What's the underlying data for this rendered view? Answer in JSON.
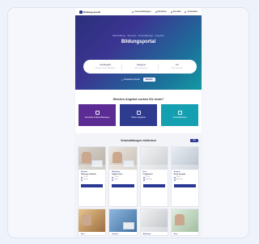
{
  "header": {
    "logo": "Bildungsportal",
    "nav": [
      "Veranstaltungen",
      "Merkliste",
      "Kontakt",
      "Anmelden"
    ]
  },
  "hero": {
    "breadcrumb": "Weiterbildung · Seminare · Veranstaltungen · Angebote",
    "title": "Bildungsportal",
    "search": {
      "fields": [
        {
          "label": "Suchbegriff",
          "placeholder": "Thema, Kurs, Stichwort"
        },
        {
          "label": "Kategorie",
          "placeholder": "Alle Kategorien"
        },
        {
          "label": "Ort",
          "placeholder": "PLZ oder Ort"
        }
      ]
    },
    "link_label": "Erweiterte Suche",
    "button_label": "Suchen"
  },
  "question": "Welches Angebot suchen Sie heute?",
  "tiles": [
    {
      "label": "Seminare & Weiterbildungen"
    },
    {
      "label": "Online-Angebote"
    },
    {
      "label": "Veranstaltungen"
    }
  ],
  "events": {
    "title": "Veranstaltungen entdecken",
    "all_label": "Alle",
    "cards": [
      {
        "category": "Seminar",
        "title": "Führung im Wandel",
        "date": "12.03.",
        "place": "Online"
      },
      {
        "category": "Workshop",
        "title": "Digitale Lehre",
        "date": "18.03.",
        "place": "Berlin"
      },
      {
        "category": "Kurs",
        "title": "Projektarbeit",
        "date": "22.03.",
        "place": "Hamburg"
      },
      {
        "category": "Seminar",
        "title": "Recht kompakt",
        "date": "29.03.",
        "place": "München"
      }
    ],
    "cards_row2": [
      {
        "category": "Kurs"
      },
      {
        "category": "Seminar"
      },
      {
        "category": "Workshop"
      },
      {
        "category": "Kurs"
      }
    ]
  },
  "colors": {
    "primary": "#2a3893",
    "tile_purple": "#5c2b93",
    "tile_blue": "#2f3b8f",
    "tile_teal": "#14a0b0"
  }
}
